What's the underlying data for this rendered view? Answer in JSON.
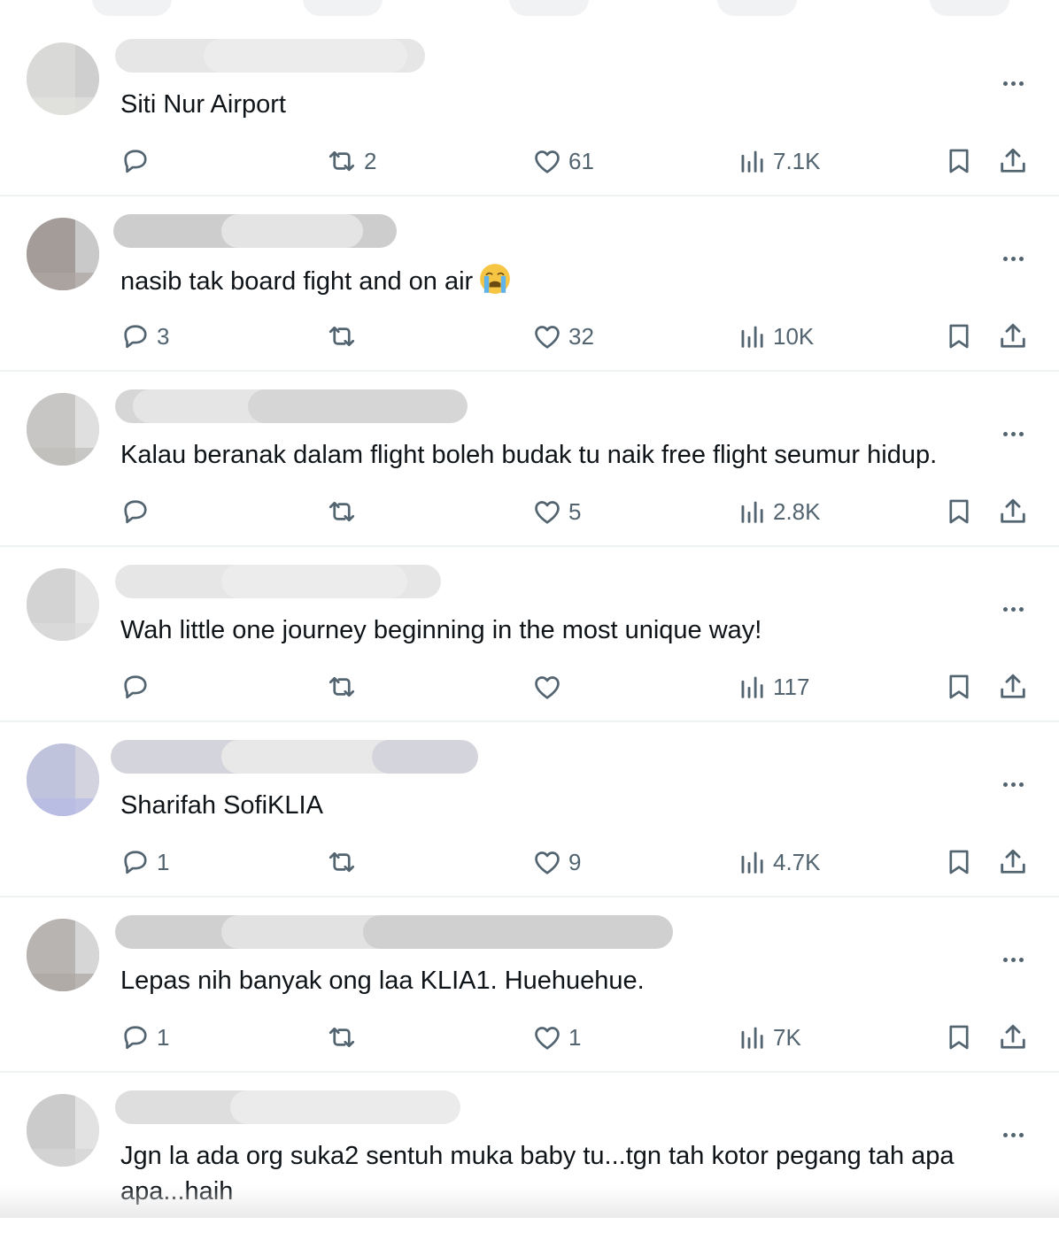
{
  "replies": [
    {
      "text": "Siti Nur Airport",
      "reply_count": "",
      "repost_count": "2",
      "like_count": "61",
      "view_count": "7.1K",
      "emoji": "",
      "avatar_colors": [
        "#e2e2e0",
        "#d9d9d7",
        "#cfcfcf"
      ],
      "name_blur_colors": [
        "#e6e6e6",
        "#ececec"
      ]
    },
    {
      "text": "nasib tak board fight and on air",
      "reply_count": "3",
      "repost_count": "",
      "like_count": "32",
      "view_count": "10K",
      "emoji": "loudly-crying-face",
      "avatar_colors": [
        "#aea7a2",
        "#a49c98",
        "#c9c9c9"
      ],
      "name_blur_colors": [
        "#cdcdcd",
        "#e4e4e4"
      ]
    },
    {
      "text": "Kalau beranak dalam flight boleh budak tu naik free flight seumur hidup.",
      "reply_count": "",
      "repost_count": "",
      "like_count": "5",
      "view_count": "2.8K",
      "emoji": "",
      "avatar_colors": [
        "#bdbdbb",
        "#c8c6c4",
        "#dedfde"
      ],
      "name_blur_colors": [
        "#d6d6d6",
        "#e5e5e5"
      ]
    },
    {
      "text": "Wah little one journey beginning in the most unique way!",
      "reply_count": "",
      "repost_count": "",
      "like_count": "",
      "view_count": "117",
      "emoji": "",
      "avatar_colors": [
        "#dcdcdc",
        "#d3d3d3",
        "#e6e6e6"
      ],
      "name_blur_colors": [
        "#e6e6e6",
        "#ececec"
      ]
    },
    {
      "text": "Sharifah SofiKLIA",
      "reply_count": "1",
      "repost_count": "",
      "like_count": "9",
      "view_count": "4.7K",
      "emoji": "",
      "avatar_colors": [
        "#b6bbe6",
        "#c0c3dc",
        "#d2d3de"
      ],
      "name_blur_colors": [
        "#d4d4dc",
        "#e8e8e8"
      ]
    },
    {
      "text": "Lepas nih banyak ong laa KLIA1. Huehuehue.",
      "reply_count": "1",
      "repost_count": "",
      "like_count": "1",
      "view_count": "7K",
      "emoji": "",
      "avatar_colors": [
        "#aca6a2",
        "#b8b4b1",
        "#d6d6d6"
      ],
      "name_blur_colors": [
        "#d0d0d0",
        "#e2e2e2"
      ]
    },
    {
      "text": "Jgn la ada org suka2 sentuh muka baby tu...tgn tah kotor pegang tah apa apa...haih",
      "reply_count": "",
      "repost_count": "",
      "like_count": "",
      "view_count": "",
      "emoji": "",
      "avatar_colors": [
        "#d6d6d6",
        "#cbcbcb",
        "#e2e2e2"
      ],
      "name_blur_colors": [
        "#dedede",
        "#ebebeb"
      ]
    }
  ],
  "colors": {
    "text": "#0f1419",
    "icon": "#536471",
    "divider": "#eff3f4"
  },
  "icons": [
    "reply-icon",
    "repost-icon",
    "like-icon",
    "views-icon",
    "bookmark-icon",
    "share-icon",
    "more-icon"
  ]
}
